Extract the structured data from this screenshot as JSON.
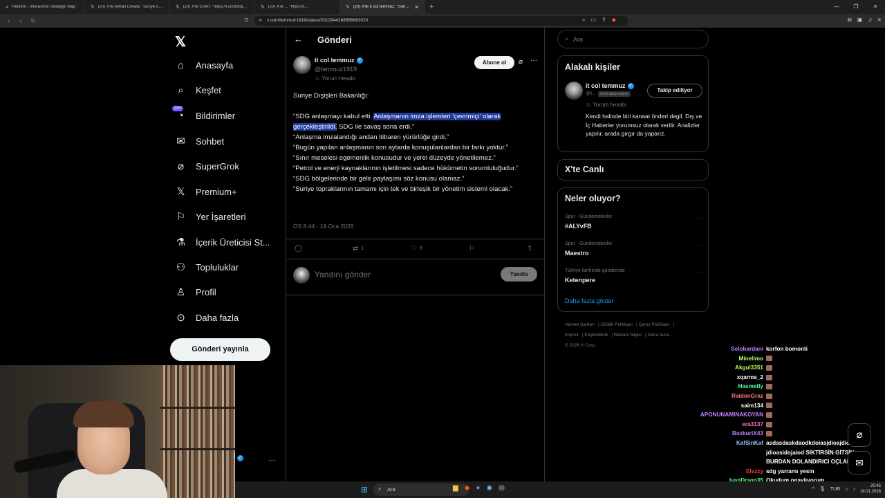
{
  "browser": {
    "tabs": [
      {
        "title": "Redline - Interactive Strategic Map",
        "icon": "globe-icon",
        "active": false
      },
      {
        "title": "(20) X'te Ayhan Erkara: \"Suriye ordus",
        "icon": "x-logo-icon",
        "active": false
      },
      {
        "title": "(20) X'te Erem: \"https://t.co/9obqVe\"",
        "icon": "x-logo-icon",
        "active": false
      },
      {
        "title": "(20) X'te ... \"https://t...",
        "icon": "x-logo-icon",
        "active": false
      },
      {
        "title": "(20) X'te it col temmuz: \"Suriye D",
        "icon": "x-logo-icon",
        "active": true
      }
    ],
    "url": "x.com/temmuz1919/status/2012944268956963020"
  },
  "leftnav": {
    "items": [
      {
        "label": "Anasayfa",
        "icon": "home-icon"
      },
      {
        "label": "Keşfet",
        "icon": "search-icon"
      },
      {
        "label": "Bildirimler",
        "icon": "bell-icon",
        "badge": "20+"
      },
      {
        "label": "Sohbet",
        "icon": "mail-icon"
      },
      {
        "label": "SuperGrok",
        "icon": "grok-icon"
      },
      {
        "label": "Premium+",
        "icon": "x-logo-icon"
      },
      {
        "label": "Yer İşaretleri",
        "icon": "bookmark-icon"
      },
      {
        "label": "İçerik Üreticisi St...",
        "icon": "flask-icon"
      },
      {
        "label": "Topluluklar",
        "icon": "people-icon"
      },
      {
        "label": "Profil",
        "icon": "person-icon"
      },
      {
        "label": "Daha fazla",
        "icon": "more-circle-icon"
      }
    ],
    "post_button": "Gönderi yayınla"
  },
  "post": {
    "header": "Gönderi",
    "author_name": "it col temmuz",
    "author_handle": "@temmuz1919",
    "parody_label": "Yorum hesabı",
    "subscribe_label": "Abone ol",
    "lead": "Suriye Dışişleri Bakanlığı:",
    "line1_pre": "“SDG anlaşmayı kabul etti. ",
    "line1_hl_a": "Anlaşmanın imza işlemleri 'çevrimiçi' olarak",
    "line1_hl_b": "gerçekleştirildi.",
    "line1_post": " SDG ile savaş sona erdi.”",
    "line2": "“Anlaşma imzalandığı andan itibaren yürürlüğe girdi.”",
    "line3": "“Bugün yapılan anlaşmanın son aylarda konuşulanlardan bir farkı yoktur.”",
    "line4": "“Sınır meselesi egemenlik konusudur ve yerel düzeyde yönetilemez.”",
    "line5": "“Petrol ve enerji kaynaklarının işletilmesi sadece hükümetin sorumluluğudur.”",
    "line6": "“SDG bölgelerinde bir gelir paylaşımı söz konusu olamaz.”",
    "line7": "“Suriye topraklarının tamamı için tek ve birleşik bir yönetim sistemi olacak.”",
    "timestamp": "ÖS 8:44 · 18 Oca 2026",
    "retweets": "1",
    "likes": "6",
    "reply_placeholder": "Yanıtını gönder",
    "reply_button": "Yanıtla"
  },
  "right": {
    "search_placeholder": "Ara",
    "related_title": "Alakalı kişiler",
    "related_name": "it col temmuz",
    "related_handle": "@t...",
    "related_follows": "Seni takip ediyor",
    "related_parody": "Yorum hesabı",
    "related_button": "Takip ediliyor",
    "related_bio": "Kendi halinde biri kanaat önderi degil. Dış ve İç Haberler yorumsuz olarak verilir. Analizler yapılır, arada gırgır da yaparız.",
    "live_title": "X'te Canlı",
    "trends_title": "Neler oluyor?",
    "trends": [
      {
        "category": "Spor · Gündemdekiler",
        "name": "#ALYvFB"
      },
      {
        "category": "Spor · Gündemdekiler",
        "name": "Maestro"
      },
      {
        "category": "Türkiye tarihinde gündemde",
        "name": "Ketenpere"
      }
    ],
    "show_more": "Daha fazla göster",
    "footer": [
      "Hizmet Şartları",
      "Gizlilik Politikası",
      "Çerez Politikası",
      "Imprint",
      "Erişilebilirlik",
      "Reklam bilgisi",
      "Daha fazla ...",
      "© 2026 X Corp."
    ]
  },
  "overlay": {
    "name_partial": "i",
    "chat": [
      {
        "user": "Selobardani",
        "msg": "korfon bomonti",
        "color": "#c77dff"
      },
      {
        "user": "Minelimo",
        "msg": "",
        "color": "#b8ff5c"
      },
      {
        "user": "Akgul3351",
        "msg": "",
        "color": "#b8ff5c"
      },
      {
        "user": "xqarms_2",
        "msg": "",
        "color": "#ffffff"
      },
      {
        "user": "Hasmetly",
        "msg": "",
        "color": "#5cffb0"
      },
      {
        "user": "RaidonGraz",
        "msg": "",
        "color": "#ff7a7a"
      },
      {
        "user": "saim134",
        "msg": "",
        "color": "#ffffff"
      },
      {
        "user": "APONUNAMINAKOYAN",
        "msg": "",
        "color": "#c77dff"
      },
      {
        "user": "era3137",
        "msg": "",
        "color": "#ff7ad9"
      },
      {
        "user": "BozkurtX43",
        "msg": "",
        "color": "#c77dff"
      },
      {
        "user": "KafSinKaf",
        "msg": "asdasdaskdaodkdoiasjdioajdioasjdas",
        "color": "#8ec5ff"
      },
      {
        "user": "",
        "msg": "jdioasidojaiod SİKTİRSİN GİTSİN",
        "color": "#ffffff"
      },
      {
        "user": "",
        "msg": "BURDAN DOLANDIRICI OÇLAR",
        "color": "#ffffff"
      },
      {
        "user": "Elvzzy",
        "msg": "sdg yarramı yesin",
        "color": "#ff3b3b"
      },
      {
        "user": "IvanDrago35",
        "msg": "Okudum onaylıyorum",
        "color": "#5cff7a"
      },
      {
        "user": "BozkurtX43",
        "msg": "",
        "color": "#c77dff"
      }
    ]
  },
  "taskbar": {
    "search_placeholder": "Ara",
    "lang": "TUR",
    "time": "20:45",
    "date": "18.01.2026"
  }
}
